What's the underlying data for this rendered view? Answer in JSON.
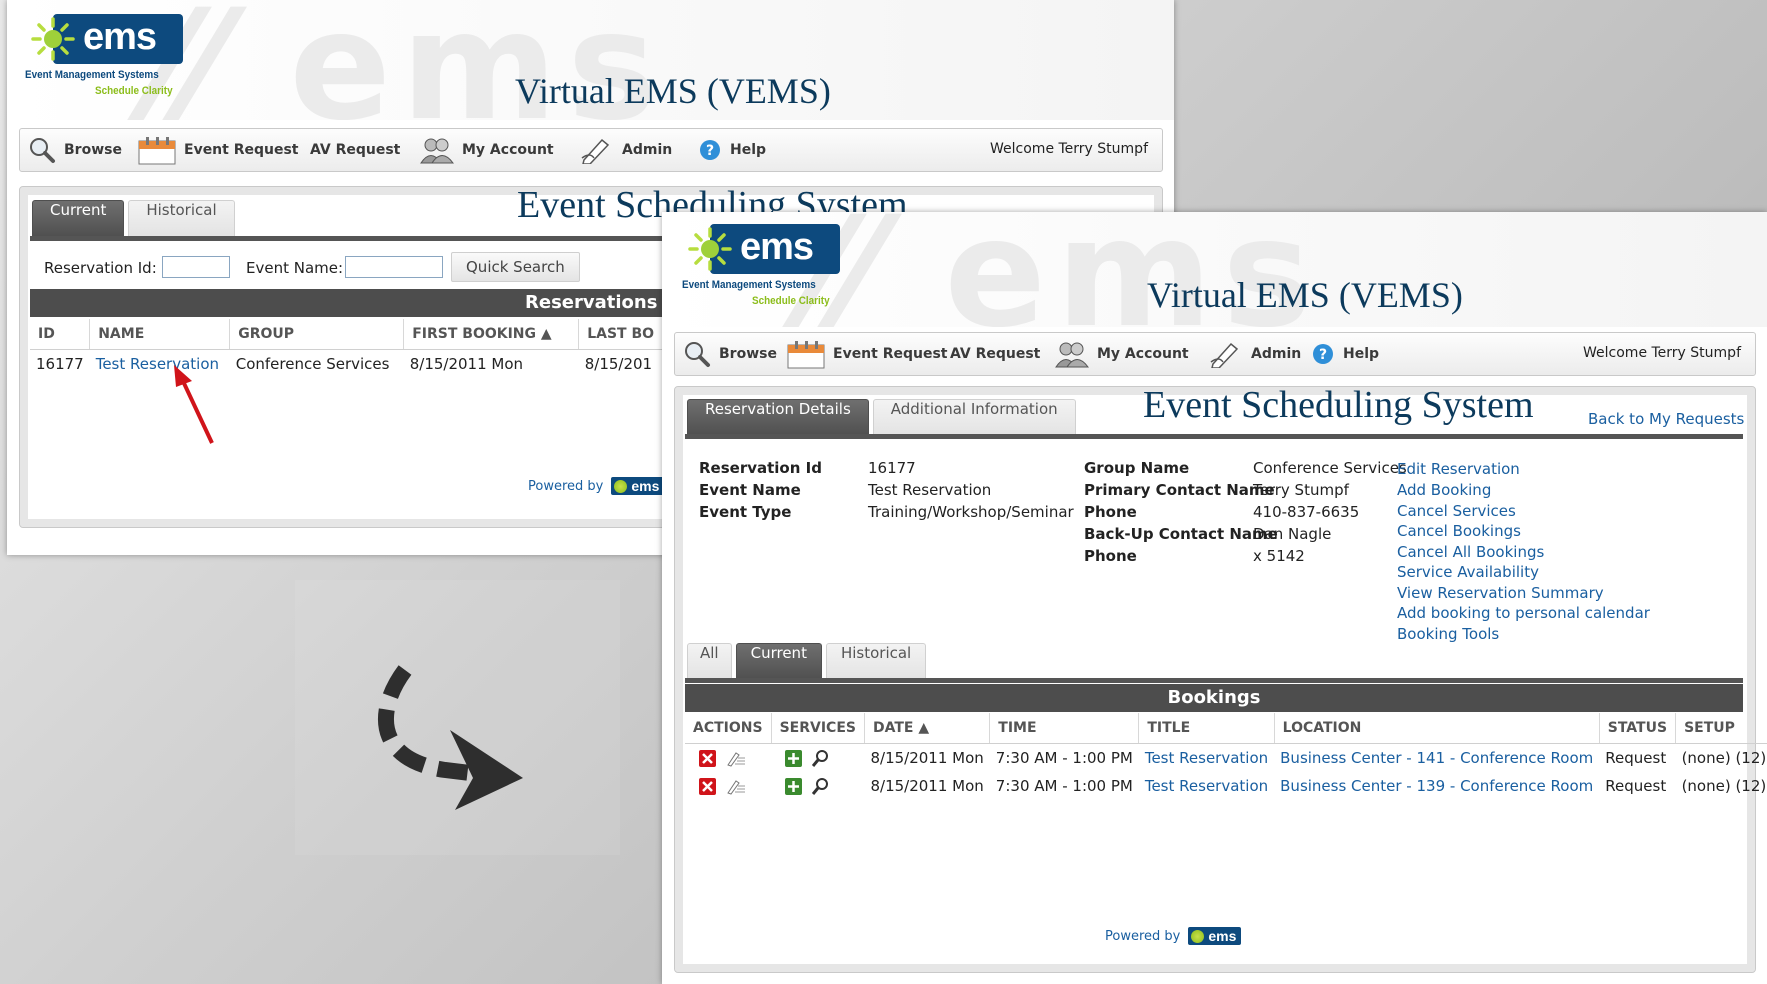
{
  "brand": {
    "logo_word": "ems",
    "logo_sub1": "Event Management Systems",
    "logo_sub2": "Schedule Clarity",
    "app_title": "Virtual EMS (VEMS)",
    "page_title": "Event Scheduling System",
    "powered_by": "Powered by",
    "mini_logo": "ems"
  },
  "nav": {
    "items": [
      {
        "label": "Browse",
        "icon": "magnifier-icon"
      },
      {
        "label": "Event Request",
        "icon": "calendar-icon"
      },
      {
        "label": "AV Request",
        "icon": ""
      },
      {
        "label": "My Account",
        "icon": "users-icon"
      },
      {
        "label": "Admin",
        "icon": "pencil-icon"
      },
      {
        "label": "Help",
        "icon": "help-icon"
      }
    ],
    "welcome": "Welcome Terry Stumpf"
  },
  "screen1": {
    "tabs": [
      "Current",
      "Historical"
    ],
    "reservation_id_label": "Reservation Id:",
    "event_name_label": "Event Name:",
    "quick_search": "Quick Search",
    "reservations_header": "Reservations",
    "columns": [
      "ID",
      "NAME",
      "GROUP",
      "FIRST BOOKING ▲",
      "LAST BO"
    ],
    "rows": [
      {
        "id": "16177",
        "name": "Test Reservation",
        "group": "Conference Services",
        "first": "8/15/2011 Mon",
        "last": "8/15/201"
      }
    ]
  },
  "screen2": {
    "tabs": [
      "Reservation Details",
      "Additional Information"
    ],
    "back_link": "Back to My Requests",
    "details_left": [
      {
        "label": "Reservation Id",
        "value": "16177"
      },
      {
        "label": "Event Name",
        "value": "Test Reservation"
      },
      {
        "label": "Event Type",
        "value": "Training/Workshop/Seminar"
      }
    ],
    "details_right": [
      {
        "label": "Group Name",
        "value": "Conference Services"
      },
      {
        "label": "Primary Contact Name",
        "value": "Terry Stumpf"
      },
      {
        "label": "Phone",
        "value": "410-837-6635"
      },
      {
        "label": "Back-Up Contact Name",
        "value": "Dan Nagle"
      },
      {
        "label": "Phone",
        "value": "x 5142"
      }
    ],
    "actions": [
      "Edit Reservation",
      "Add Booking",
      "Cancel Services",
      "Cancel Bookings",
      "Cancel All Bookings",
      "Service Availability",
      "View Reservation Summary",
      "Add booking to personal calendar",
      "Booking Tools"
    ],
    "booking_tabs": [
      "All",
      "Current",
      "Historical"
    ],
    "bookings_header": "Bookings",
    "columns": [
      "ACTIONS",
      "SERVICES",
      "DATE ▲",
      "TIME",
      "TITLE",
      "LOCATION",
      "STATUS",
      "SETUP"
    ],
    "rows": [
      {
        "date": "8/15/2011 Mon",
        "time": "7:30 AM - 1:00 PM",
        "title": "Test Reservation",
        "location": "Business Center - 141 - Conference Room",
        "status": "Request",
        "setup": "(none) (12)"
      },
      {
        "date": "8/15/2011 Mon",
        "time": "7:30 AM - 1:00 PM",
        "title": "Test Reservation",
        "location": "Business Center - 139 - Conference Room",
        "status": "Request",
        "setup": "(none) (12)"
      }
    ]
  },
  "colors": {
    "brand_blue": "#0d4a7e",
    "brand_green": "#8cbd1b",
    "title_navy": "#0c3a5c",
    "link_blue": "#1a5fa0",
    "bar_dark": "#4d4d4d",
    "arrow_red": "#d0141a"
  }
}
